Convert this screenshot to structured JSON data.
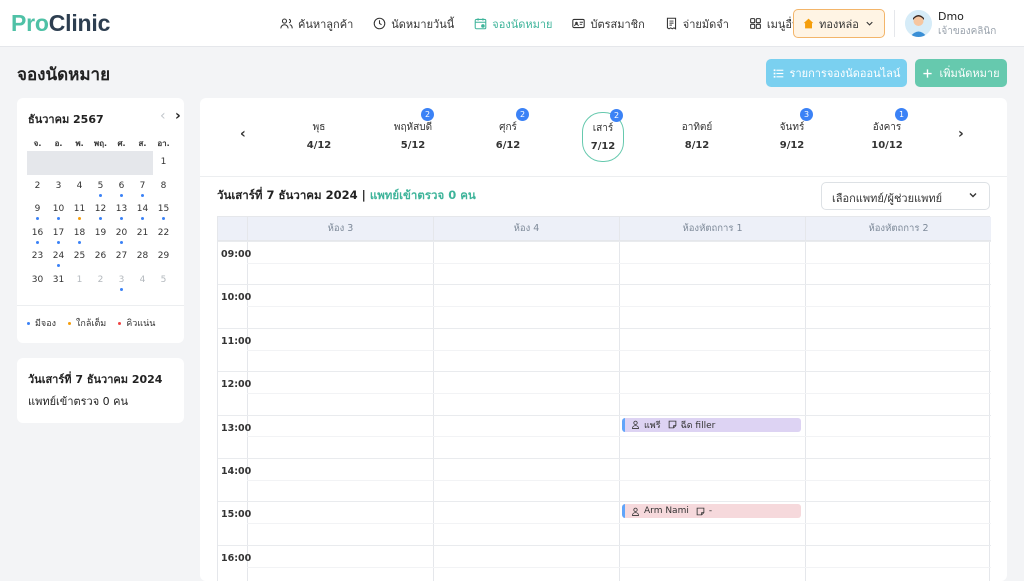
{
  "brand": {
    "pro": "Pro",
    "clinic": "Clinic"
  },
  "nav": {
    "items": [
      {
        "label": "ค้นหาลูกค้า",
        "icon": "users-icon"
      },
      {
        "label": "นัดหมายวันนี้",
        "icon": "clock-icon"
      },
      {
        "label": "จองนัดหมาย",
        "icon": "calendar-icon",
        "active": true
      },
      {
        "label": "บัตรสมาชิก",
        "icon": "id-card-icon"
      },
      {
        "label": "จ่ายมัดจำ",
        "icon": "receipt-icon"
      },
      {
        "label": "เมนูอื่นๆ",
        "icon": "grid-icon"
      }
    ],
    "branch": "ทองหล่อ",
    "user_name": "Dmo",
    "user_role": "เจ้าของคลินิก"
  },
  "page": {
    "title": "จองนัดหมาย",
    "online_button": "รายการจองนัดออนไลน์",
    "add_button": "เพิ่มนัดหมาย"
  },
  "mini_calendar": {
    "title": "ธันวาคม 2567",
    "weekdays": [
      "จ.",
      "อ.",
      "พ.",
      "พฤ.",
      "ศ.",
      "ส.",
      "อา."
    ],
    "weeks": [
      [
        null,
        null,
        null,
        null,
        null,
        null,
        {
          "d": "1"
        }
      ],
      [
        {
          "d": "2"
        },
        {
          "d": "3"
        },
        {
          "d": "4"
        },
        {
          "d": "5",
          "dot": "blue"
        },
        {
          "d": "6",
          "dot": "blue"
        },
        {
          "d": "7",
          "dot": "blue"
        },
        {
          "d": "8"
        }
      ],
      [
        {
          "d": "9",
          "dot": "blue"
        },
        {
          "d": "10",
          "dot": "blue"
        },
        {
          "d": "11",
          "dot": "orange"
        },
        {
          "d": "12",
          "dot": "blue"
        },
        {
          "d": "13",
          "dot": "blue"
        },
        {
          "d": "14",
          "dot": "blue"
        },
        {
          "d": "15",
          "dot": "blue"
        }
      ],
      [
        {
          "d": "16",
          "dot": "blue"
        },
        {
          "d": "17",
          "dot": "blue"
        },
        {
          "d": "18",
          "dot": "blue"
        },
        {
          "d": "19"
        },
        {
          "d": "20",
          "dot": "blue"
        },
        {
          "d": "21"
        },
        {
          "d": "22"
        }
      ],
      [
        {
          "d": "23"
        },
        {
          "d": "24",
          "dot": "blue"
        },
        {
          "d": "25"
        },
        {
          "d": "26"
        },
        {
          "d": "27"
        },
        {
          "d": "28"
        },
        {
          "d": "29"
        }
      ],
      [
        {
          "d": "30"
        },
        {
          "d": "31"
        },
        {
          "d": "1",
          "other": true
        },
        {
          "d": "2",
          "other": true
        },
        {
          "d": "3",
          "other": true,
          "dot": "blue"
        },
        {
          "d": "4",
          "other": true
        },
        {
          "d": "5",
          "other": true
        }
      ]
    ],
    "legend": [
      {
        "label": "มีจอง",
        "color": "#3b82f6"
      },
      {
        "label": "ใกล้เต็ม",
        "color": "#f59e0b"
      },
      {
        "label": "คิวแน่น",
        "color": "#ef4444"
      }
    ]
  },
  "day_card": {
    "date": "วันเสาร์ที่ 7 ธันวาคม 2024",
    "doctors": "แพทย์เข้าตรวจ 0 คน"
  },
  "week": [
    {
      "name": "พุธ",
      "date": "4/12",
      "badge": ""
    },
    {
      "name": "พฤหัสบดี",
      "date": "5/12",
      "badge": "2"
    },
    {
      "name": "ศุกร์",
      "date": "6/12",
      "badge": "2"
    },
    {
      "name": "เสาร์",
      "date": "7/12",
      "badge": "2",
      "selected": true
    },
    {
      "name": "อาทิตย์",
      "date": "8/12",
      "badge": ""
    },
    {
      "name": "จันทร์",
      "date": "9/12",
      "badge": "3"
    },
    {
      "name": "อังคาร",
      "date": "10/12",
      "badge": "1"
    }
  ],
  "schedule": {
    "title_date": "วันเสาร์ที่ 7 ธันวาคม 2024",
    "title_sep": "|",
    "title_doctors": "แพทย์เข้าตรวจ 0 คน",
    "doctor_select": "เลือกแพทย์/ผู้ช่วยแพทย์",
    "rooms": [
      "ห้อง 3",
      "ห้อง 4",
      "ห้องหัตถการ 1",
      "ห้องหัตถการ 2"
    ],
    "times": [
      "09:00",
      "10:00",
      "11:00",
      "12:00",
      "13:00",
      "14:00",
      "15:00",
      "16:00"
    ],
    "appointments": [
      {
        "room": 2,
        "hour": 4,
        "name": "แพรี",
        "service": "ฉีด filler",
        "color": "#ddd3f3"
      },
      {
        "room": 2,
        "hour": 6,
        "name": "Arm Nami",
        "service": "-",
        "color": "#f6d9dc"
      }
    ]
  }
}
